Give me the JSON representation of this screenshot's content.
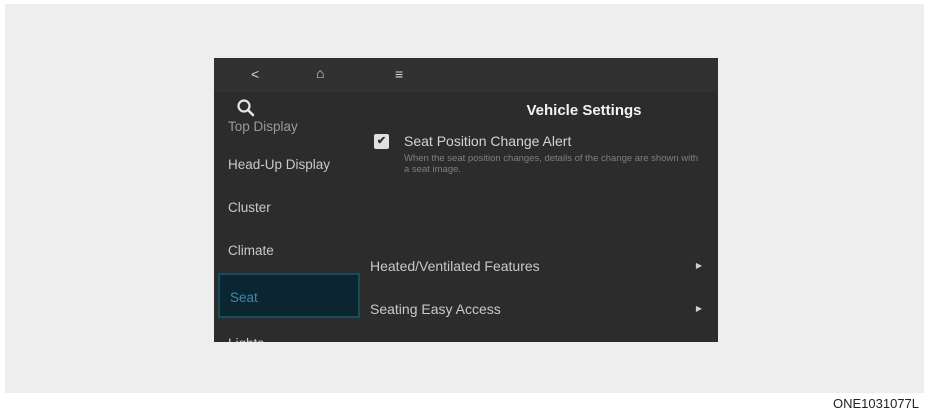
{
  "topbar": {
    "back_icon": "<",
    "home_icon": "⌂",
    "menu_icon": "≡"
  },
  "header": {
    "title": "Vehicle Settings",
    "search_icon": "search-icon"
  },
  "sidebar": {
    "items": [
      {
        "label": "Top Display"
      },
      {
        "label": "Head-Up Display"
      },
      {
        "label": "Cluster"
      },
      {
        "label": "Climate"
      },
      {
        "label": "Seat",
        "selected": true
      },
      {
        "label": "Lights"
      }
    ]
  },
  "content": {
    "seat_alert": {
      "label": "Seat Position Change Alert",
      "checked": true,
      "check_glyph": "✔",
      "description": "When the seat position changes, details of the change are shown with a seat image."
    },
    "menu": [
      {
        "label": "Heated/Ventilated Features",
        "arrow": "▶"
      },
      {
        "label": "Seating Easy Access",
        "arrow": "▶"
      }
    ]
  },
  "figure_code": "ONE1031077L",
  "colors": {
    "screen_bg": "#2c2c2c",
    "selected_bg": "#0b2630",
    "selected_border": "#1a4c5c",
    "selected_text": "#3f8aa3",
    "panel_bg": "#eeeeee"
  }
}
